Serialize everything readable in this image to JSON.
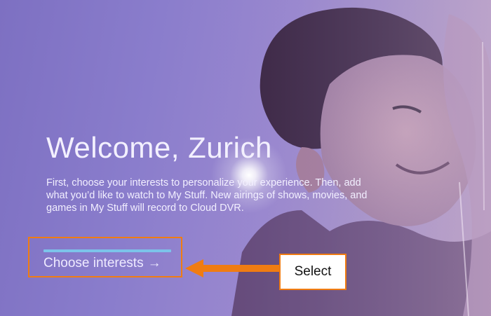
{
  "welcome": {
    "title": "Welcome, Zurich",
    "intro": "First, choose your interests to personalize your experience. Then, add what you’d like to watch to My Stuff. New airings of shows, movies, and games in My Stuff will record to Cloud DVR."
  },
  "choose_interests": {
    "label": "Choose interests",
    "arrow": "→"
  },
  "annotation": {
    "label": "Select"
  },
  "colors": {
    "background": "#8a7dcc",
    "focus_bar": "#7cc3ea",
    "annotation_border": "#f07c12",
    "text": "#f2efff"
  },
  "icons": {
    "button_arrow": "arrow-right-icon",
    "annotation_arrow": "orange-arrow-left-icon"
  }
}
